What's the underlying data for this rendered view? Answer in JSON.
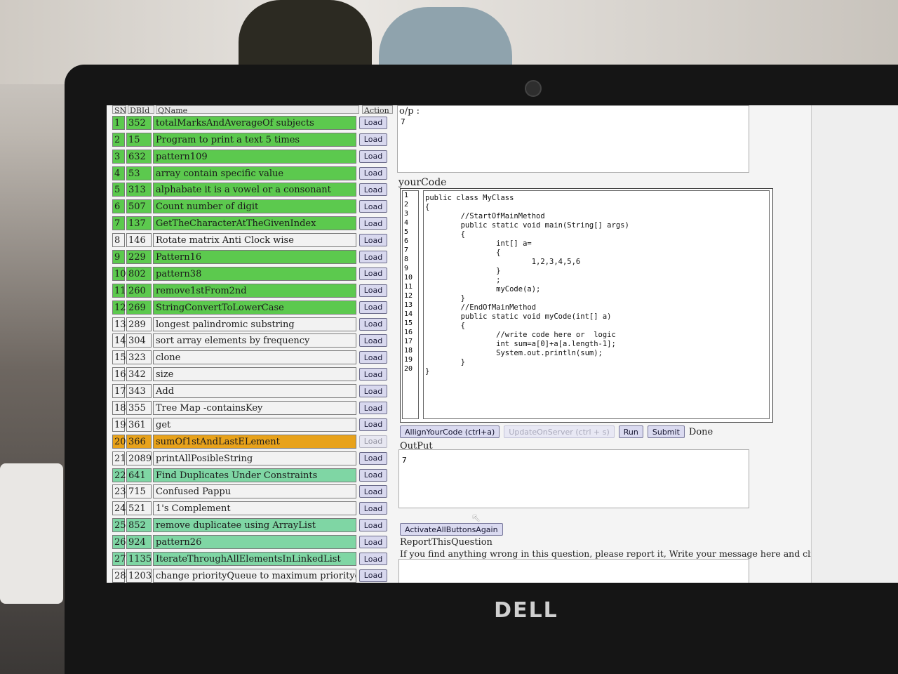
{
  "table": {
    "headers": [
      "SN",
      "DBId",
      "QName",
      "Action"
    ],
    "rows": [
      {
        "sn": "1",
        "id": "352",
        "name": "totalMarksAndAverageOf subjects",
        "action": "Load",
        "status": "green"
      },
      {
        "sn": "2",
        "id": "15",
        "name": "Program to print a text 5 times",
        "action": "Load",
        "status": "green"
      },
      {
        "sn": "3",
        "id": "632",
        "name": "pattern109",
        "action": "Load",
        "status": "green"
      },
      {
        "sn": "4",
        "id": "53",
        "name": "array contain specific value",
        "action": "Load",
        "status": "green"
      },
      {
        "sn": "5",
        "id": "313",
        "name": "alphabate it is a vowel or a consonant",
        "action": "Load",
        "status": "green"
      },
      {
        "sn": "6",
        "id": "507",
        "name": "Count number of digit",
        "action": "Load",
        "status": "green"
      },
      {
        "sn": "7",
        "id": "137",
        "name": "GetTheCharacterAtTheGivenIndex",
        "action": "Load",
        "status": "green"
      },
      {
        "sn": "8",
        "id": "146",
        "name": "Rotate matrix Anti Clock wise",
        "action": "Load",
        "status": "white"
      },
      {
        "sn": "9",
        "id": "229",
        "name": "Pattern16",
        "action": "Load",
        "status": "green"
      },
      {
        "sn": "10",
        "id": "802",
        "name": "pattern38",
        "action": "Load",
        "status": "green"
      },
      {
        "sn": "11",
        "id": "260",
        "name": "remove1stFrom2nd",
        "action": "Load",
        "status": "green"
      },
      {
        "sn": "12",
        "id": "269",
        "name": "StringConvertToLowerCase",
        "action": "Load",
        "status": "green"
      },
      {
        "sn": "13",
        "id": "289",
        "name": "longest palindromic substring",
        "action": "Load",
        "status": "white"
      },
      {
        "sn": "14",
        "id": "304",
        "name": "sort array elements by frequency",
        "action": "Load",
        "status": "white"
      },
      {
        "sn": "15",
        "id": "323",
        "name": "clone",
        "action": "Load",
        "status": "white"
      },
      {
        "sn": "16",
        "id": "342",
        "name": "size",
        "action": "Load",
        "status": "white"
      },
      {
        "sn": "17",
        "id": "343",
        "name": "Add",
        "action": "Load",
        "status": "white"
      },
      {
        "sn": "18",
        "id": "355",
        "name": "Tree Map -containsKey",
        "action": "Load",
        "status": "white"
      },
      {
        "sn": "19",
        "id": "361",
        "name": "get",
        "action": "Load",
        "status": "white"
      },
      {
        "sn": "20",
        "id": "366",
        "name": "sumOf1stAndLastELement",
        "action": "Load",
        "status": "orange"
      },
      {
        "sn": "21",
        "id": "2089",
        "name": "printAllPosibleString",
        "action": "Load",
        "status": "white"
      },
      {
        "sn": "22",
        "id": "641",
        "name": "Find Duplicates Under Constraints",
        "action": "Load",
        "status": "lightgreen"
      },
      {
        "sn": "23",
        "id": "715",
        "name": "Confused Pappu",
        "action": "Load",
        "status": "white"
      },
      {
        "sn": "24",
        "id": "521",
        "name": "1's Complement",
        "action": "Load",
        "status": "white"
      },
      {
        "sn": "25",
        "id": "852",
        "name": "remove duplicatee using ArrayList",
        "action": "Load",
        "status": "lightgreen"
      },
      {
        "sn": "26",
        "id": "924",
        "name": "pattern26",
        "action": "Load",
        "status": "lightgreen"
      },
      {
        "sn": "27",
        "id": "1135",
        "name": "IterateThroughAllElementsInLinkedList",
        "action": "Load",
        "status": "lightgreen"
      },
      {
        "sn": "28",
        "id": "1203",
        "name": "change priorityQueue to maximum priorityqueue",
        "action": "Load",
        "status": "white"
      }
    ]
  },
  "expected_output": {
    "label": "o/p :",
    "value": "7"
  },
  "editor": {
    "label": "yourCode",
    "line_numbers": "1\n2\n3\n4\n5\n6\n7\n8\n9\n10\n11\n12\n13\n14\n15\n16\n17\n18\n19\n20",
    "code": "public class MyClass\n{\n        //StartOfMainMethod\n        public static void main(String[] args)\n        {\n                int[] a=\n                {\n                        1,2,3,4,5,6\n                }\n                ;\n                myCode(a);\n        }\n        //EndOfMainMethod\n        public static void myCode(int[] a)\n        {\n                //write code here or  logic\n                int sum=a[0]+a[a.length-1];\n                System.out.println(sum);\n        }\n}"
  },
  "buttons": {
    "align": "AllignYourCode (ctrl+a)",
    "update": "UpdateOnServer (ctrl + s)",
    "run": "Run",
    "submit": "Submit",
    "status": "Done",
    "activate": "ActivateAllButtonsAgain"
  },
  "output": {
    "label": "OutPut",
    "value": "7"
  },
  "report": {
    "title": "ReportThisQuestion",
    "message": "If you find anything wrong in this question, please report it, Write your message here and click \"Report\""
  },
  "brand": {
    "logo": "DELL"
  },
  "colors": {
    "green": "#5cc94e",
    "lightgreen": "#7fd6a4",
    "orange": "#e8a21a",
    "white": "#f2f2f2"
  }
}
